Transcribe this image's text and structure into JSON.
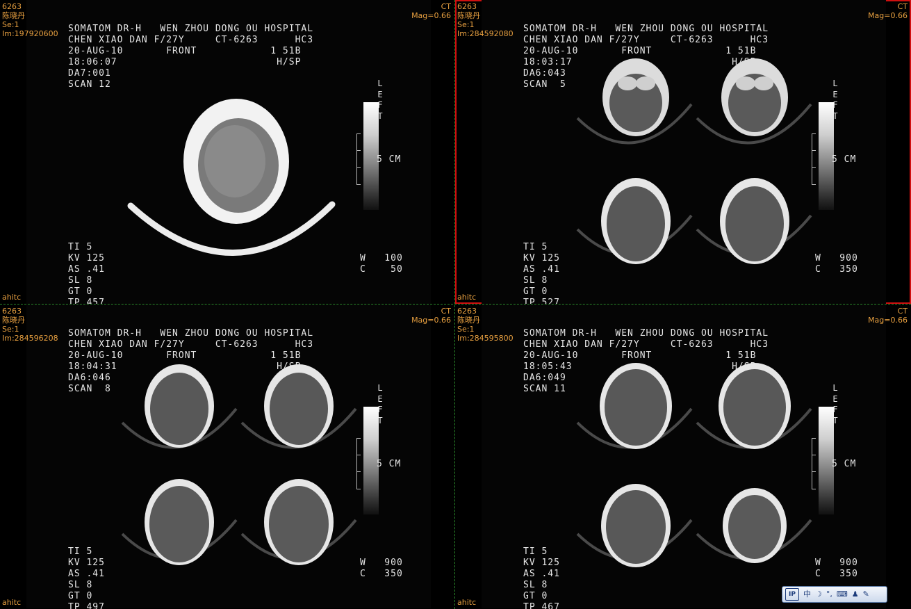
{
  "panes": [
    {
      "corner": {
        "id": "6263",
        "name": "陈晓丹",
        "series": "Se:1",
        "image": "Im:197920600",
        "modality": "CT",
        "mag": "Mag=0.66",
        "user": "ahitc"
      },
      "film": {
        "row1": "SOMATOM DR-H   WEN ZHOU DONG OU HOSPITAL",
        "row2": "CHEN XIAO DAN F/27Y     CT-6263      HC3",
        "row3": "20-AUG-10       FRONT            1 51B",
        "row4": "18:06:07                          H/SP",
        "row5": "DA7:001",
        "row6": "SCAN 12",
        "params": [
          "TI 5",
          "KV 125",
          "AS .41",
          "SL 8",
          "GT 0",
          "TP 457"
        ],
        "window": [
          "W   100",
          "C    50"
        ],
        "scale_label": "5 CM",
        "lut_letters": [
          "L",
          "E",
          "F",
          "T"
        ]
      }
    },
    {
      "corner": {
        "id": "6263",
        "name": "陈晓丹",
        "series": "Se:1",
        "image": "Im:284592080",
        "modality": "CT",
        "mag": "Mag=0.66",
        "user": "ahitc"
      },
      "film": {
        "row1": "SOMATOM DR-H   WEN ZHOU DONG OU HOSPITAL",
        "row2": "CHEN XIAO DAN F/27Y     CT-6263      HC3",
        "row3": "20-AUG-10       FRONT            1 51B",
        "row4": "18:03:17                          H/SP",
        "row5": "DA6:043",
        "row6": "SCAN  5",
        "params": [
          "TI 5",
          "KV 125",
          "AS .41",
          "SL 8",
          "GT 0",
          "TP 527"
        ],
        "window": [
          "W   900",
          "C   350"
        ],
        "scale_label": "5 CM",
        "lut_letters": [
          "L",
          "E",
          "F",
          "T"
        ]
      }
    },
    {
      "corner": {
        "id": "6263",
        "name": "陈晓丹",
        "series": "Se:1",
        "image": "Im:284596208",
        "modality": "CT",
        "mag": "Mag=0.66",
        "user": "ahitc"
      },
      "film": {
        "row1": "SOMATOM DR-H   WEN ZHOU DONG OU HOSPITAL",
        "row2": "CHEN XIAO DAN F/27Y     CT-6263      HC3",
        "row3": "20-AUG-10       FRONT            1 51B",
        "row4": "18:04:31                          H/SP",
        "row5": "DA6:046",
        "row6": "SCAN  8",
        "params": [
          "TI 5",
          "KV 125",
          "AS .41",
          "SL 8",
          "GT 0",
          "TP 497"
        ],
        "window": [
          "W   900",
          "C   350"
        ],
        "scale_label": "5 CM",
        "lut_letters": [
          "L",
          "E",
          "F",
          "T"
        ]
      }
    },
    {
      "corner": {
        "id": "6263",
        "name": "陈晓丹",
        "series": "Se:1",
        "image": "Im:284595800",
        "modality": "CT",
        "mag": "Mag=0.66",
        "user": "ahitc"
      },
      "film": {
        "row1": "SOMATOM DR-H   WEN ZHOU DONG OU HOSPITAL",
        "row2": "CHEN XIAO DAN F/27Y     CT-6263      HC3",
        "row3": "20-AUG-10       FRONT            1 51B",
        "row4": "18:05:43                          H/SP",
        "row5": "DA6:049",
        "row6": "SCAN 11",
        "params": [
          "TI 5",
          "KV 125",
          "AS .41",
          "SL 8",
          "GT 0",
          "TP 467"
        ],
        "window": [
          "W   900",
          "C   350"
        ],
        "scale_label": "5 CM",
        "lut_letters": [
          "L",
          "E",
          "F",
          "T"
        ]
      }
    }
  ],
  "taskbar": {
    "ime_logo": "IP",
    "ime_mode": "中",
    "icons": [
      "moon-icon",
      "dots-icon",
      "keyboard-icon",
      "user-icon",
      "wrench-icon"
    ]
  },
  "colors": {
    "overlay_text": "#e8a040",
    "active_border": "#d01010",
    "divider": "#2a8a2a",
    "film_text": "#e6e6e6"
  }
}
